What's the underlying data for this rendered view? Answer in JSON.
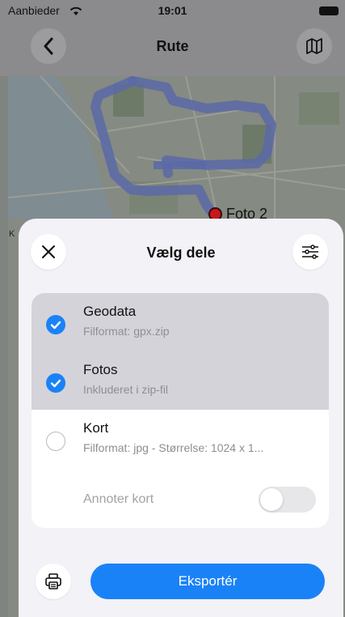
{
  "status": {
    "carrier": "Aanbieder",
    "time": "19:01"
  },
  "nav": {
    "title": "Rute",
    "back_icon": "chevron-left-icon",
    "map_icon": "map-icon"
  },
  "map": {
    "marker_label": "Foto 2",
    "edge_label": "K"
  },
  "sheet": {
    "title": "Vælg dele",
    "close_icon": "close-icon",
    "settings_icon": "sliders-icon",
    "items": [
      {
        "title": "Geodata",
        "subtitle": "Filformat: gpx.zip",
        "checked": true
      },
      {
        "title": "Fotos",
        "subtitle": "Inkluderet i zip-fil",
        "checked": true
      },
      {
        "title": "Kort",
        "subtitle": "Filformat: jpg - Størrelse: 1024 x 1...",
        "checked": false
      }
    ],
    "annotate_label": "Annoter kort",
    "annotate_on": false,
    "export_label": "Eksportér",
    "print_icon": "printer-icon"
  },
  "colors": {
    "accent": "#1a82f7",
    "selected_row": "#d4d3da",
    "sheet_bg": "#f2f2f7",
    "route": "#5a68a8",
    "marker": "#c8171b"
  }
}
